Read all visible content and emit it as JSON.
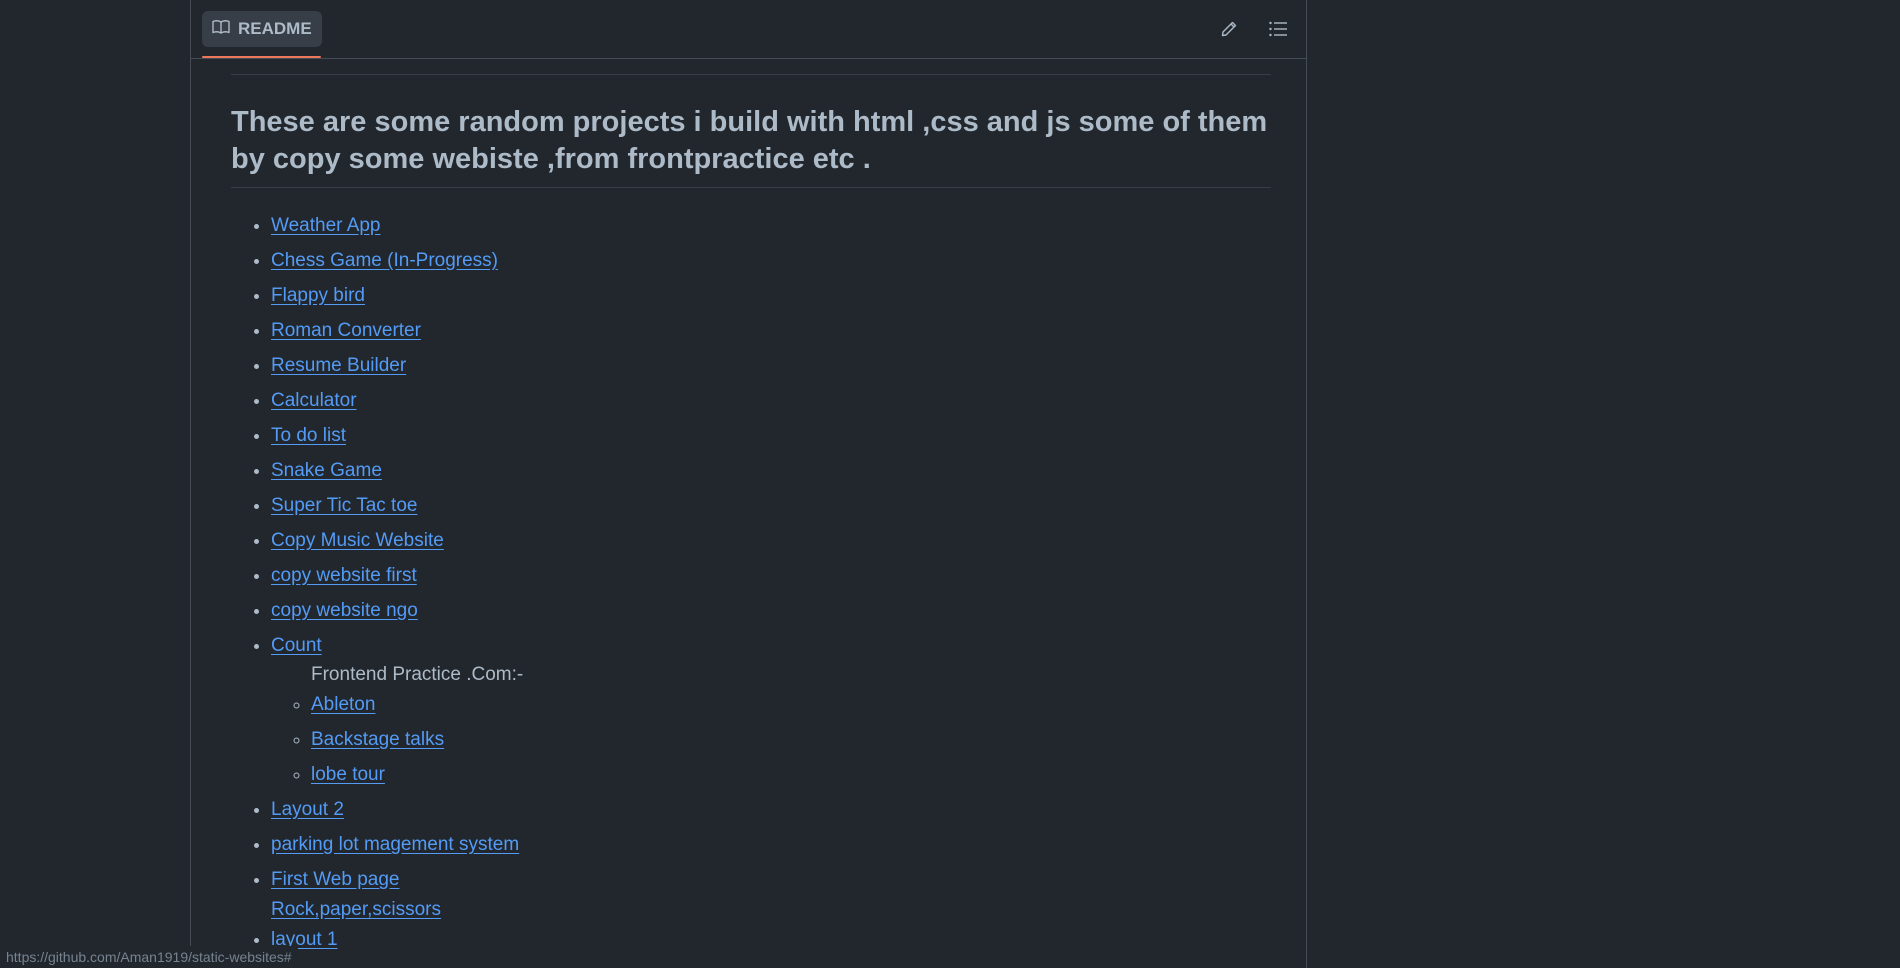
{
  "readme_tab": {
    "label": "README",
    "icon": "book-icon"
  },
  "header_actions": {
    "edit_icon": "pencil-icon",
    "outline_icon": "list-unordered-icon"
  },
  "heading": "These are some random projects i build with html ,css and js some of them by copy some webiste ,from frontpractice etc .",
  "projects": [
    "Weather App",
    "Chess Game (In-Progress)",
    "Flappy bird",
    "Roman Converter",
    "Resume Builder",
    "Calculator",
    "To do list",
    "Snake Game",
    "Super Tic Tac toe",
    "Copy Music Website",
    "copy website first",
    "copy website ngo",
    "Count"
  ],
  "frontend_practice": {
    "label": "Frontend Practice .Com:-",
    "items": [
      "Ableton",
      "Backstage talks",
      "lobe tour"
    ]
  },
  "projects_after": [
    "Layout 2",
    "parking lot magement system",
    "First Web page"
  ],
  "rock_paper_scissors": "Rock,paper,scissors",
  "projects_end": [
    "layout 1"
  ],
  "status_url": "https://github.com/Aman1919/static-websites#",
  "colors": {
    "background": "#22272e",
    "text": "#adbac7",
    "link": "#539bf5",
    "border": "#444c56",
    "tab_underline": "#ec775c"
  }
}
